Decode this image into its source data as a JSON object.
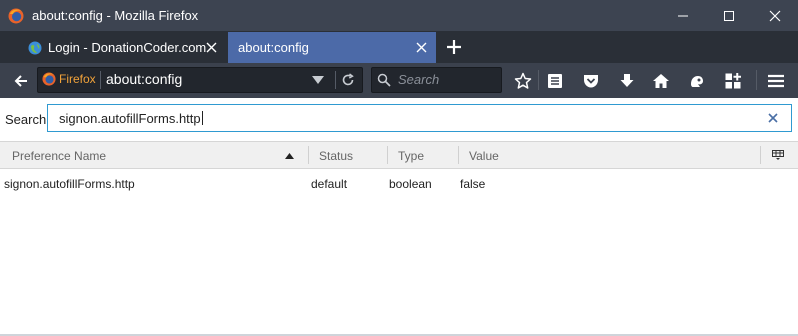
{
  "window": {
    "title": "about:config - Mozilla Firefox",
    "controls": [
      "minimize",
      "maximize",
      "close"
    ]
  },
  "tabs": [
    {
      "label": "Login - DonationCoder.com",
      "active": false,
      "icon": "globe-icon"
    },
    {
      "label": "about:config",
      "active": true
    }
  ],
  "navbar": {
    "identity_label": "Firefox",
    "url": "about:config",
    "search_placeholder": "Search",
    "toolbar_icons": [
      "star-icon",
      "reading-list-icon",
      "pocket-icon",
      "download-icon",
      "home-icon",
      "sync-icon",
      "extensions-icon",
      "menu-icon"
    ]
  },
  "config": {
    "search_label": "Search:",
    "search_value": "signon.autofillForms.http",
    "columns": {
      "name": "Preference Name",
      "status": "Status",
      "type": "Type",
      "value": "Value"
    },
    "rows": [
      {
        "name": "signon.autofillForms.http",
        "status": "default",
        "type": "boolean",
        "value": "false"
      }
    ]
  },
  "colors": {
    "titlebar": "#3d4451",
    "tabstrip": "#2a2f37",
    "active_tab": "#4c6aa8",
    "navbar": "#3b414d",
    "firefox_orange": "#f2a33a",
    "search_focus": "#2f9ad1"
  }
}
